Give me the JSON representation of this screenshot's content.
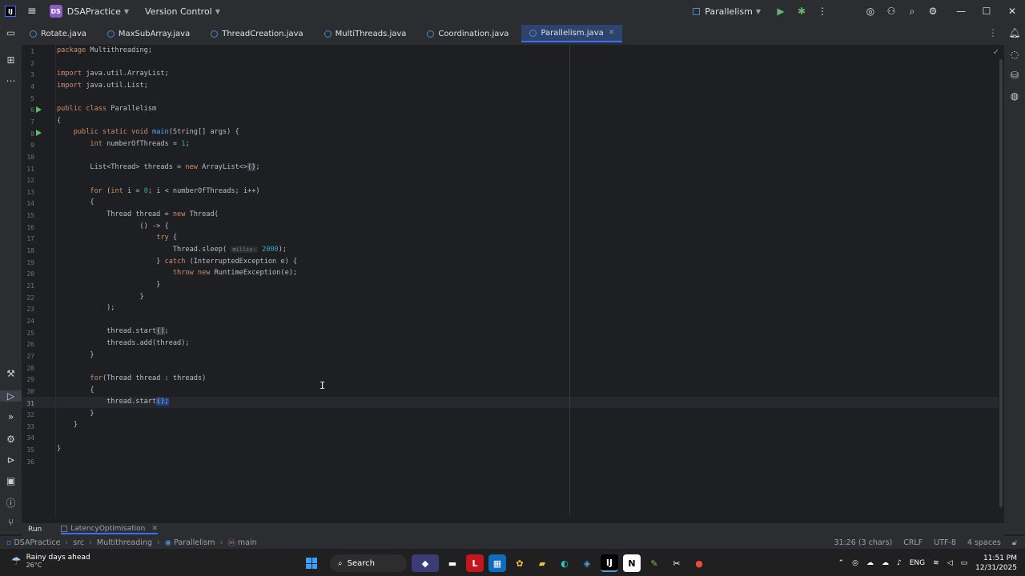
{
  "titlebar": {
    "project_badge": "DS",
    "project_name": "DSAPractice",
    "vcs_label": "Version Control",
    "run_config": "Parallelism"
  },
  "tabs": [
    {
      "label": "Rotate.java",
      "active": false
    },
    {
      "label": "MaxSubArray.java",
      "active": false
    },
    {
      "label": "ThreadCreation.java",
      "active": false
    },
    {
      "label": "MultiThreads.java",
      "active": false
    },
    {
      "label": "Coordination.java",
      "active": false
    },
    {
      "label": "Parallelism.java",
      "active": true
    }
  ],
  "editor": {
    "line_numbers": [
      "1",
      "2",
      "3",
      "4",
      "5",
      "6",
      "7",
      "8",
      "9",
      "10",
      "11",
      "12",
      "13",
      "14",
      "15",
      "16",
      "17",
      "18",
      "19",
      "20",
      "21",
      "22",
      "23",
      "24",
      "25",
      "26",
      "27",
      "28",
      "29",
      "30",
      "31",
      "32",
      "33",
      "34",
      "35",
      "36"
    ],
    "current_line": "31",
    "param_hint": "millis:"
  },
  "run_panel": {
    "label": "Run",
    "tab": "LatencyOptimisation"
  },
  "statusbar": {
    "breadcrumbs": [
      "DSAPractice",
      "src",
      "Multithreading",
      "Parallelism",
      "main"
    ],
    "position": "31:26 (3 chars)",
    "line_sep": "CRLF",
    "encoding": "UTF-8",
    "indent": "4 spaces"
  },
  "taskbar": {
    "weather_title": "Rainy days ahead",
    "weather_temp": "26°C",
    "search_label": "Search",
    "lang": "ENG",
    "time": "11:51 PM",
    "date": "12/31/2025"
  }
}
